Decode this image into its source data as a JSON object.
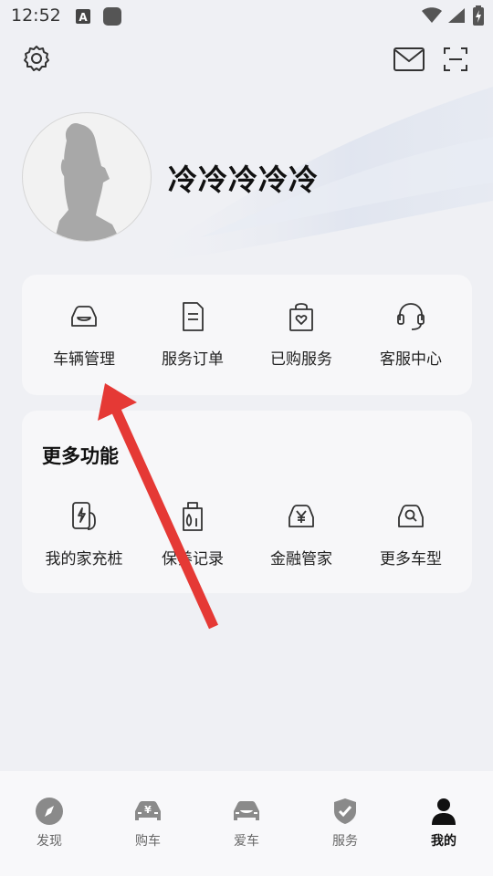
{
  "status_bar": {
    "time": "12:52",
    "icons": [
      "notification-a-icon",
      "app-square-icon",
      "wifi-icon",
      "signal-icon",
      "battery-charging-icon"
    ]
  },
  "header": {
    "settings_icon": "gear-icon",
    "mail_icon": "mail-icon",
    "scan_icon": "scan-icon"
  },
  "profile": {
    "username": "冷冷冷冷冷",
    "avatar_icon": "default-avatar-silhouette"
  },
  "quick_actions": [
    {
      "label": "车辆管理",
      "icon": "car-icon"
    },
    {
      "label": "服务订单",
      "icon": "document-icon"
    },
    {
      "label": "已购服务",
      "icon": "shopping-bag-icon"
    },
    {
      "label": "客服中心",
      "icon": "headset-icon"
    }
  ],
  "more_features": {
    "title": "更多功能",
    "items": [
      {
        "label": "我的家充桩",
        "icon": "charging-pile-icon"
      },
      {
        "label": "保养记录",
        "icon": "oil-can-icon"
      },
      {
        "label": "金融管家",
        "icon": "car-finance-icon"
      },
      {
        "label": "更多车型",
        "icon": "car-search-icon"
      }
    ]
  },
  "bottom_nav": [
    {
      "label": "发现",
      "icon": "compass-icon",
      "active": false
    },
    {
      "label": "购车",
      "icon": "car-purchase-icon",
      "active": false
    },
    {
      "label": "爱车",
      "icon": "my-car-icon",
      "active": false
    },
    {
      "label": "服务",
      "icon": "shield-check-icon",
      "active": false
    },
    {
      "label": "我的",
      "icon": "person-icon",
      "active": true
    }
  ],
  "colors": {
    "background": "#eff0f4",
    "card": "#f7f7f9",
    "annotation_arrow": "#e53935",
    "active_nav": "#111111",
    "inactive_nav": "#8a8a8a"
  }
}
